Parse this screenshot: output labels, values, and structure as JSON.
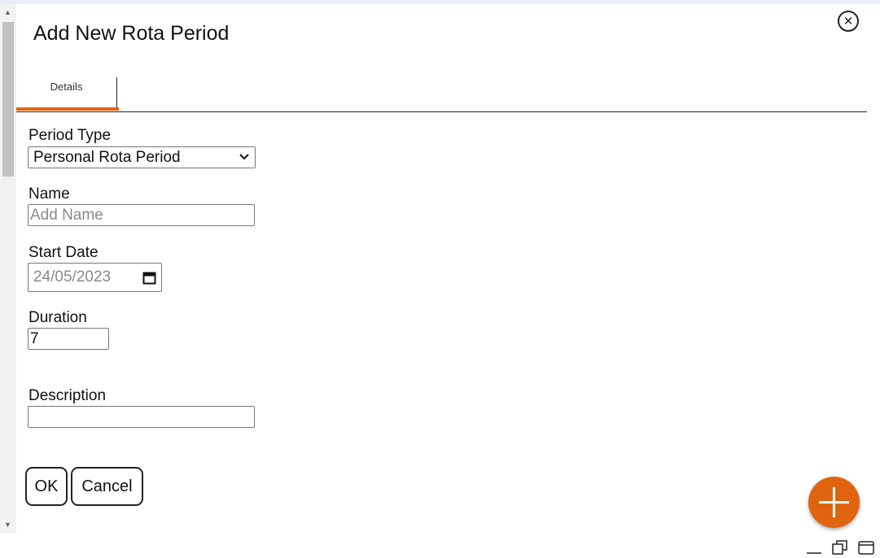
{
  "dialog": {
    "title": "Add New Rota Period",
    "close_icon": "close-circle-icon",
    "tabs": [
      {
        "label": "Details",
        "active": true
      }
    ]
  },
  "form": {
    "period_type": {
      "label": "Period Type",
      "value": "Personal Rota Period"
    },
    "name": {
      "label": "Name",
      "placeholder": "Add Name",
      "value": ""
    },
    "start_date": {
      "label": "Start Date",
      "value": "24/05/2023"
    },
    "duration": {
      "label": "Duration",
      "value": "7"
    },
    "description": {
      "label": "Description",
      "value": ""
    }
  },
  "actions": {
    "ok_label": "OK",
    "cancel_label": "Cancel"
  },
  "fab_icon": "plus-icon",
  "window_controls": [
    "minimize-icon",
    "restore-icon",
    "maximize-icon"
  ],
  "colors": {
    "accent": "#e0640f",
    "page_bg": "#e9edf7"
  }
}
